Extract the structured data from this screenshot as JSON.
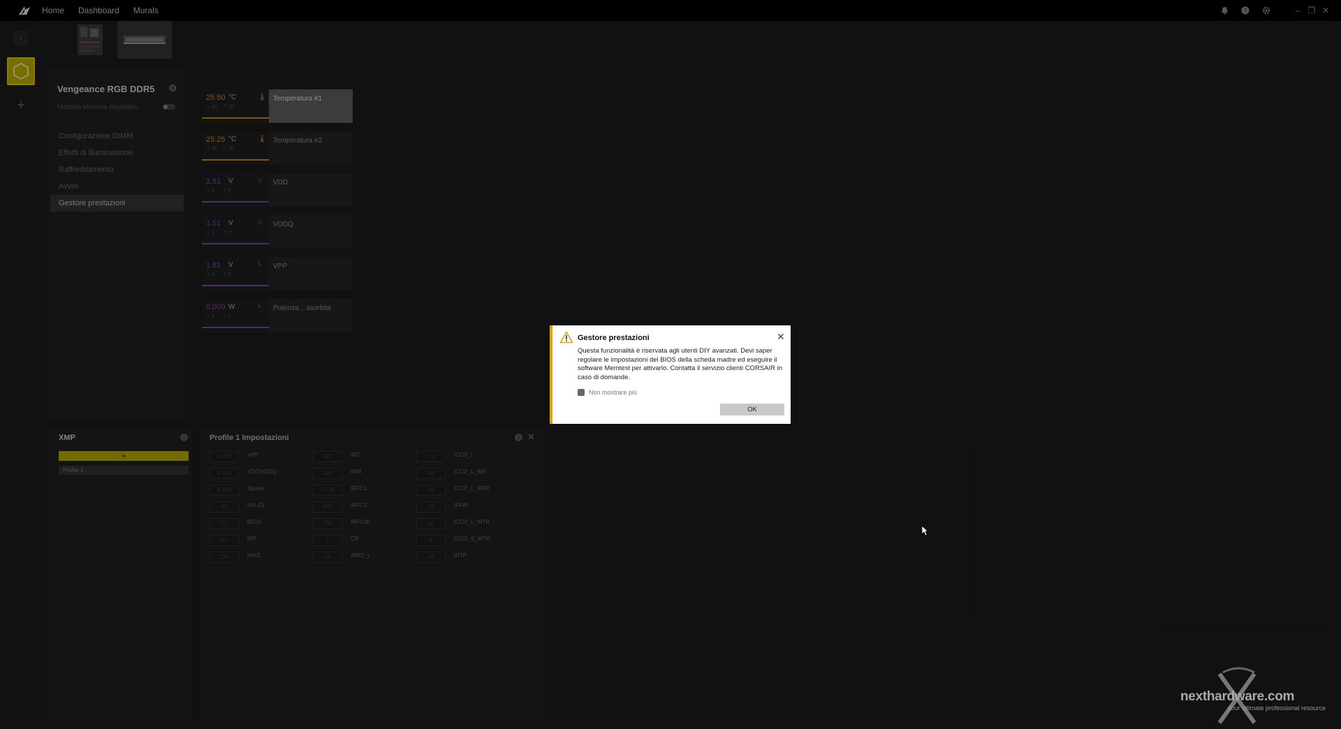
{
  "topbar": {
    "nav": [
      "Home",
      "Dashboard",
      "Murals"
    ]
  },
  "device": {
    "title": "Vengeance RGB DDR5",
    "memory_mode_label": "Modalità Memoria dispositivo"
  },
  "menu": {
    "items": [
      "Configurazione DIMM",
      "Effetti di illuminazione",
      "Raffreddamento",
      "Avvisi",
      "Gestore prestazioni"
    ],
    "active_index": 4
  },
  "sensors": [
    {
      "value": "25.50",
      "unit": "°C",
      "min": "⊥ 25",
      "max": "⊤ 26",
      "name": "Temperatura #1",
      "kind": "temperature",
      "color": "#c9851a",
      "active": true
    },
    {
      "value": "25.25",
      "unit": "°C",
      "min": "⊥ 25",
      "max": "⊤ 25",
      "name": "Temperatura #2",
      "kind": "temperature",
      "color": "#c9851a",
      "active": false
    },
    {
      "value": "1.51",
      "unit": "V",
      "min": "⊥ 2",
      "max": "⊤ 2",
      "name": "VDD",
      "kind": "voltage",
      "color": "#7a3fb0",
      "active": false
    },
    {
      "value": "1.51",
      "unit": "V",
      "min": "⊥ 2",
      "max": "⊤ 2",
      "name": "VDDQ",
      "kind": "voltage",
      "color": "#7a3fb0",
      "active": false
    },
    {
      "value": "1.81",
      "unit": "V",
      "min": "⊥ 2",
      "max": "⊤ 2",
      "name": "VPP",
      "kind": "voltage",
      "color": "#7a3fb0",
      "active": false
    },
    {
      "value": "0.000",
      "unit": "W",
      "min": "⊥ 0",
      "max": "⊤ 2",
      "name": "Potenza ...ssorbita",
      "kind": "power",
      "color": "#7a3fb0",
      "active": false
    }
  ],
  "xmp": {
    "title": "XMP",
    "add_label": "+",
    "profile": "Profile 1"
  },
  "profile_settings": {
    "title": "Profile 1 Impostazioni",
    "columns": [
      [
        {
          "value": "1.800",
          "label": "VPP"
        },
        {
          "value": "1.400",
          "label": "VDD/VDDQ"
        },
        {
          "value": "6.400",
          "label": "Speed"
        },
        {
          "value": "40",
          "label": "tAA-CL"
        },
        {
          "value": "52",
          "label": "tRCD"
        },
        {
          "value": "52",
          "label": "tRP"
        },
        {
          "value": "135",
          "label": "tRAS"
        }
      ],
      [
        {
          "value": "187",
          "label": "tRC"
        },
        {
          "value": "126",
          "label": "tWR"
        },
        {
          "value": "1.718",
          "label": "tRFC1"
        },
        {
          "value": "922",
          "label": "tRFC2"
        },
        {
          "value": "796",
          "label": "tRFCsb"
        },
        {
          "value": "2",
          "label": "CR"
        },
        {
          "value": "16",
          "label": "tRRD_L"
        }
      ],
      [
        {
          "value": "21",
          "label": "tCCD_L"
        },
        {
          "value": "84",
          "label": "tCCD_L_WR"
        },
        {
          "value": "42",
          "label": "tCCD_L_WR2"
        },
        {
          "value": "32",
          "label": "tFAW"
        },
        {
          "value": "42",
          "label": "tCCD_L_WTR"
        },
        {
          "value": "8",
          "label": "tCCD_S_WTR"
        },
        {
          "value": "32",
          "label": "tRTP"
        }
      ]
    ]
  },
  "dialog": {
    "title": "Gestore prestazioni",
    "message": "Questa funzionalità è riservata agli utenti DIY avanzati. Devi saper regolare le impostazioni del BIOS della scheda madre ed eseguire il software Memtest per attivarlo. Contatta il servizio clienti CORSAIR in caso di domande.",
    "checkbox_label": "Non mostrare più",
    "ok_label": "OK",
    "accent": "#e6a200"
  },
  "watermark": {
    "brand": "nexthardware.com",
    "tagline": "your ultimate professional resource"
  }
}
